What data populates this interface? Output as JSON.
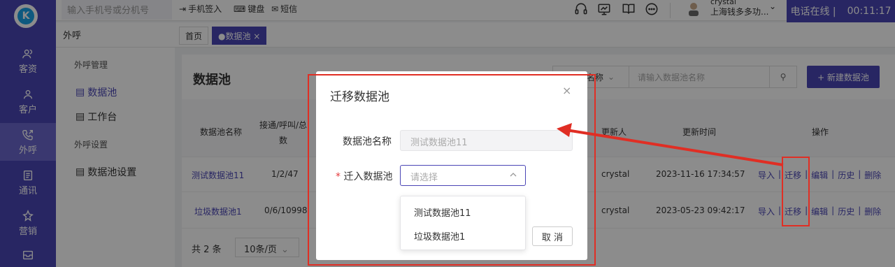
{
  "topbar": {
    "search_placeholder": "输入手机号或分机号",
    "checkin_label": "手机签入",
    "keyboard_label": "键盘",
    "sms_label": "短信",
    "user_name": "crystal",
    "company": "上海钱多多功...",
    "phone_status": "电话在线 |",
    "timer": "00:11:17"
  },
  "leftnav": {
    "logo": "K",
    "items": [
      {
        "label": "客资",
        "icon": "users-icon"
      },
      {
        "label": "客户",
        "icon": "user-icon"
      },
      {
        "label": "外呼",
        "icon": "phone-out-icon"
      },
      {
        "label": "通讯",
        "icon": "contacts-icon"
      },
      {
        "label": "营销",
        "icon": "marketing-icon"
      }
    ]
  },
  "subheader": {
    "section": "外呼",
    "tabs": [
      {
        "label": "首页"
      },
      {
        "label": "●数据池 ×"
      }
    ]
  },
  "sidemenu": {
    "group1": "外呼管理",
    "item_datapool": "数据池",
    "item_workbench": "工作台",
    "group2": "外呼设置",
    "item_settings": "数据池设置"
  },
  "main": {
    "title": "数据池",
    "filter_select": "数据池名称",
    "search_placeholder": "请输入数据池名称",
    "new_button": "+ 新建数据池",
    "columns": {
      "name": "数据池名称",
      "stats": "接通/呼叫/总数",
      "updater": "更新人",
      "updated_at": "更新时间",
      "actions": "操作"
    },
    "rows": [
      {
        "name": "测试数据池11",
        "stats": "1/2/47",
        "updater": "crystal",
        "updated_at": "2023-11-16 17:34:57"
      },
      {
        "name": "垃圾数据池1",
        "stats": "0/6/10998",
        "updater": "crystal",
        "updated_at": "2023-05-23 09:42:17"
      }
    ],
    "action_labels": {
      "import": "导入",
      "migrate": "迁移",
      "edit": "编辑",
      "history": "历史",
      "delete": "删除",
      "sep": "|"
    },
    "total": "共 2 条",
    "page_size": "10条/页"
  },
  "modal": {
    "title": "迁移数据池",
    "close": "×",
    "name_label": "数据池名称",
    "name_value": "测试数据池11",
    "target_label": "迁入数据池",
    "target_required": "*",
    "target_placeholder": "请选择",
    "options": [
      "测试数据池11",
      "垃圾数据池1"
    ],
    "cancel": "取 消"
  },
  "colors": {
    "accent": "#4a45b5",
    "annotation": "#e02e24"
  }
}
